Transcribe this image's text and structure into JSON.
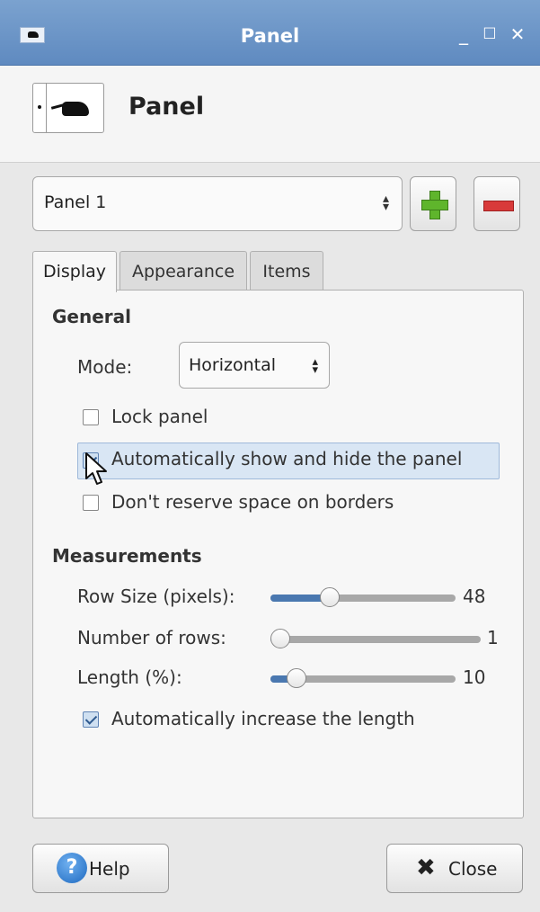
{
  "window": {
    "title": "Panel"
  },
  "header": {
    "title": "Panel"
  },
  "panel_selector": {
    "selected": "Panel 1"
  },
  "tabs": [
    {
      "label": "Display",
      "active": true
    },
    {
      "label": "Appearance",
      "active": false
    },
    {
      "label": "Items",
      "active": false
    }
  ],
  "general": {
    "heading": "General",
    "mode_label": "Mode:",
    "mode_value": "Horizontal",
    "lock_panel": {
      "label": "Lock panel",
      "checked": false
    },
    "autohide": {
      "label": "Automatically show and hide the panel",
      "checked": true
    },
    "dont_reserve": {
      "label": "Don't reserve space on borders",
      "checked": false
    }
  },
  "measurements": {
    "heading": "Measurements",
    "row_size": {
      "label": "Row Size (pixels):",
      "value": "48",
      "fraction": 0.3
    },
    "rows": {
      "label": "Number of rows:",
      "value": "1",
      "fraction": 0.0
    },
    "length": {
      "label": "Length (%):",
      "value": "10",
      "fraction": 0.1
    },
    "auto_length": {
      "label": "Automatically increase the length",
      "checked": true
    }
  },
  "buttons": {
    "help": "Help",
    "close": "Close"
  },
  "colors": {
    "titlebar": "#6b95c8",
    "accent": "#4a78b0"
  }
}
